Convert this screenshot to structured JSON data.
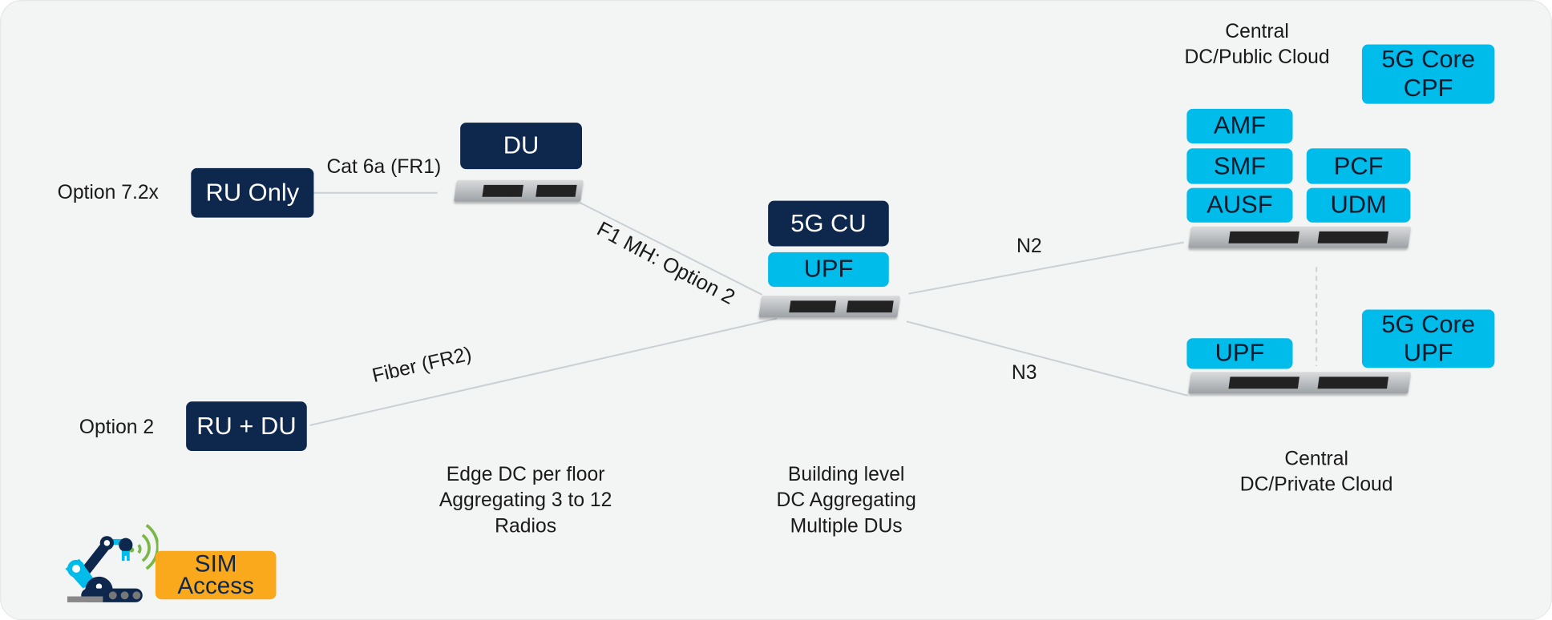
{
  "labels": {
    "option_72x": "Option 7.2x",
    "cat6a": "Cat 6a (FR1)",
    "f1mh": "F1 MH: Option 2",
    "fiber": "Fiber (FR2)",
    "option2": "Option 2",
    "n2": "N2",
    "n3": "N3"
  },
  "boxes": {
    "ru_only": "RU Only",
    "du": "DU",
    "ru_du": "RU + DU",
    "cu": "5G CU",
    "cu_upf": "UPF",
    "core_cpf_1": "5G Core",
    "core_cpf_2": "CPF",
    "amf": "AMF",
    "smf": "SMF",
    "ausf": "AUSF",
    "pcf": "PCF",
    "udm": "UDM",
    "upf": "UPF",
    "core_upf_1": "5G Core",
    "core_upf_2": "UPF",
    "sim_1": "SIM",
    "sim_2": "Access"
  },
  "captions": {
    "edge": [
      "Edge DC per floor",
      "Aggregating 3 to 12",
      "Radios"
    ],
    "building": [
      "Building level",
      "DC Aggregating",
      "Multiple DUs"
    ],
    "public": [
      "Central",
      "DC/Public Cloud"
    ],
    "private": [
      "Central",
      "DC/Private Cloud"
    ]
  },
  "colors": {
    "navy": "#0d274d",
    "cyan": "#00bceb",
    "orange": "#f9a91b",
    "background": "#f3f4f4",
    "line": "#c9d0d4"
  },
  "icons": [
    "server-icon",
    "industrial-robot-wireless-icon"
  ]
}
